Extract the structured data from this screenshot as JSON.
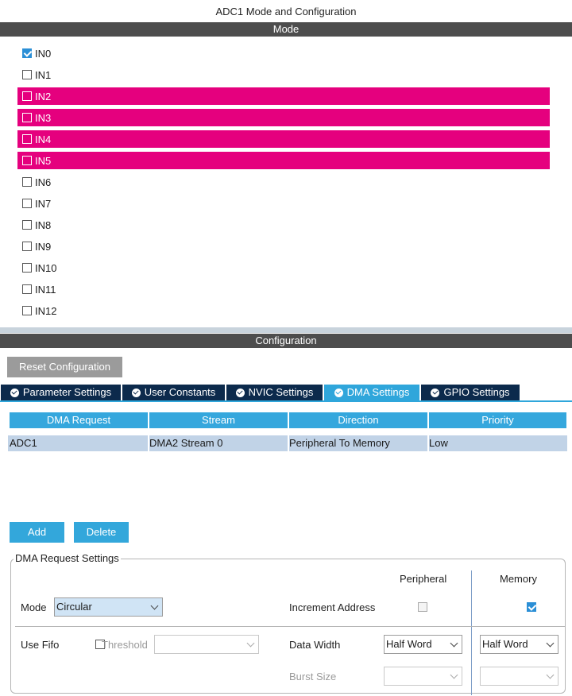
{
  "window": {
    "title": "ADC1 Mode and Configuration"
  },
  "mode": {
    "header": "Mode",
    "channels": [
      {
        "label": "IN0",
        "checked": true,
        "highlighted": false
      },
      {
        "label": "IN1",
        "checked": false,
        "highlighted": false
      },
      {
        "label": "IN2",
        "checked": false,
        "highlighted": true
      },
      {
        "label": "IN3",
        "checked": false,
        "highlighted": true
      },
      {
        "label": "IN4",
        "checked": false,
        "highlighted": true
      },
      {
        "label": "IN5",
        "checked": false,
        "highlighted": true
      },
      {
        "label": "IN6",
        "checked": false,
        "highlighted": false
      },
      {
        "label": "IN7",
        "checked": false,
        "highlighted": false
      },
      {
        "label": "IN8",
        "checked": false,
        "highlighted": false
      },
      {
        "label": "IN9",
        "checked": false,
        "highlighted": false
      },
      {
        "label": "IN10",
        "checked": false,
        "highlighted": false
      },
      {
        "label": "IN11",
        "checked": false,
        "highlighted": false
      },
      {
        "label": "IN12",
        "checked": false,
        "highlighted": false
      }
    ],
    "highlight_color": "#e5007e"
  },
  "configuration": {
    "header": "Configuration",
    "reset_label": "Reset Configuration",
    "tabs": [
      {
        "label": "Parameter Settings",
        "active": false
      },
      {
        "label": "User Constants",
        "active": false
      },
      {
        "label": "NVIC Settings",
        "active": false
      },
      {
        "label": "DMA Settings",
        "active": true
      },
      {
        "label": "GPIO Settings",
        "active": false
      }
    ],
    "accent_color": "#2fa6db",
    "tab_color": "#0c2a4c"
  },
  "dma_table": {
    "columns": [
      "DMA Request",
      "Stream",
      "Direction",
      "Priority"
    ],
    "rows": [
      [
        "ADC1",
        "DMA2 Stream 0",
        "Peripheral To Memory",
        "Low"
      ]
    ],
    "add_label": "Add",
    "delete_label": "Delete"
  },
  "dma_request_settings": {
    "legend": "DMA Request Settings",
    "peripheral_header": "Peripheral",
    "memory_header": "Memory",
    "mode_label": "Mode",
    "mode_value": "Circular",
    "increment_address_label": "Increment Address",
    "peripheral_increment": false,
    "memory_increment": true,
    "use_fifo_label": "Use Fifo",
    "use_fifo": false,
    "threshold_label": "Threshold",
    "threshold_value": "",
    "data_width_label": "Data Width",
    "peripheral_data_width": "Half Word",
    "memory_data_width": "Half Word",
    "burst_size_label": "Burst Size",
    "peripheral_burst_size": "",
    "memory_burst_size": ""
  }
}
